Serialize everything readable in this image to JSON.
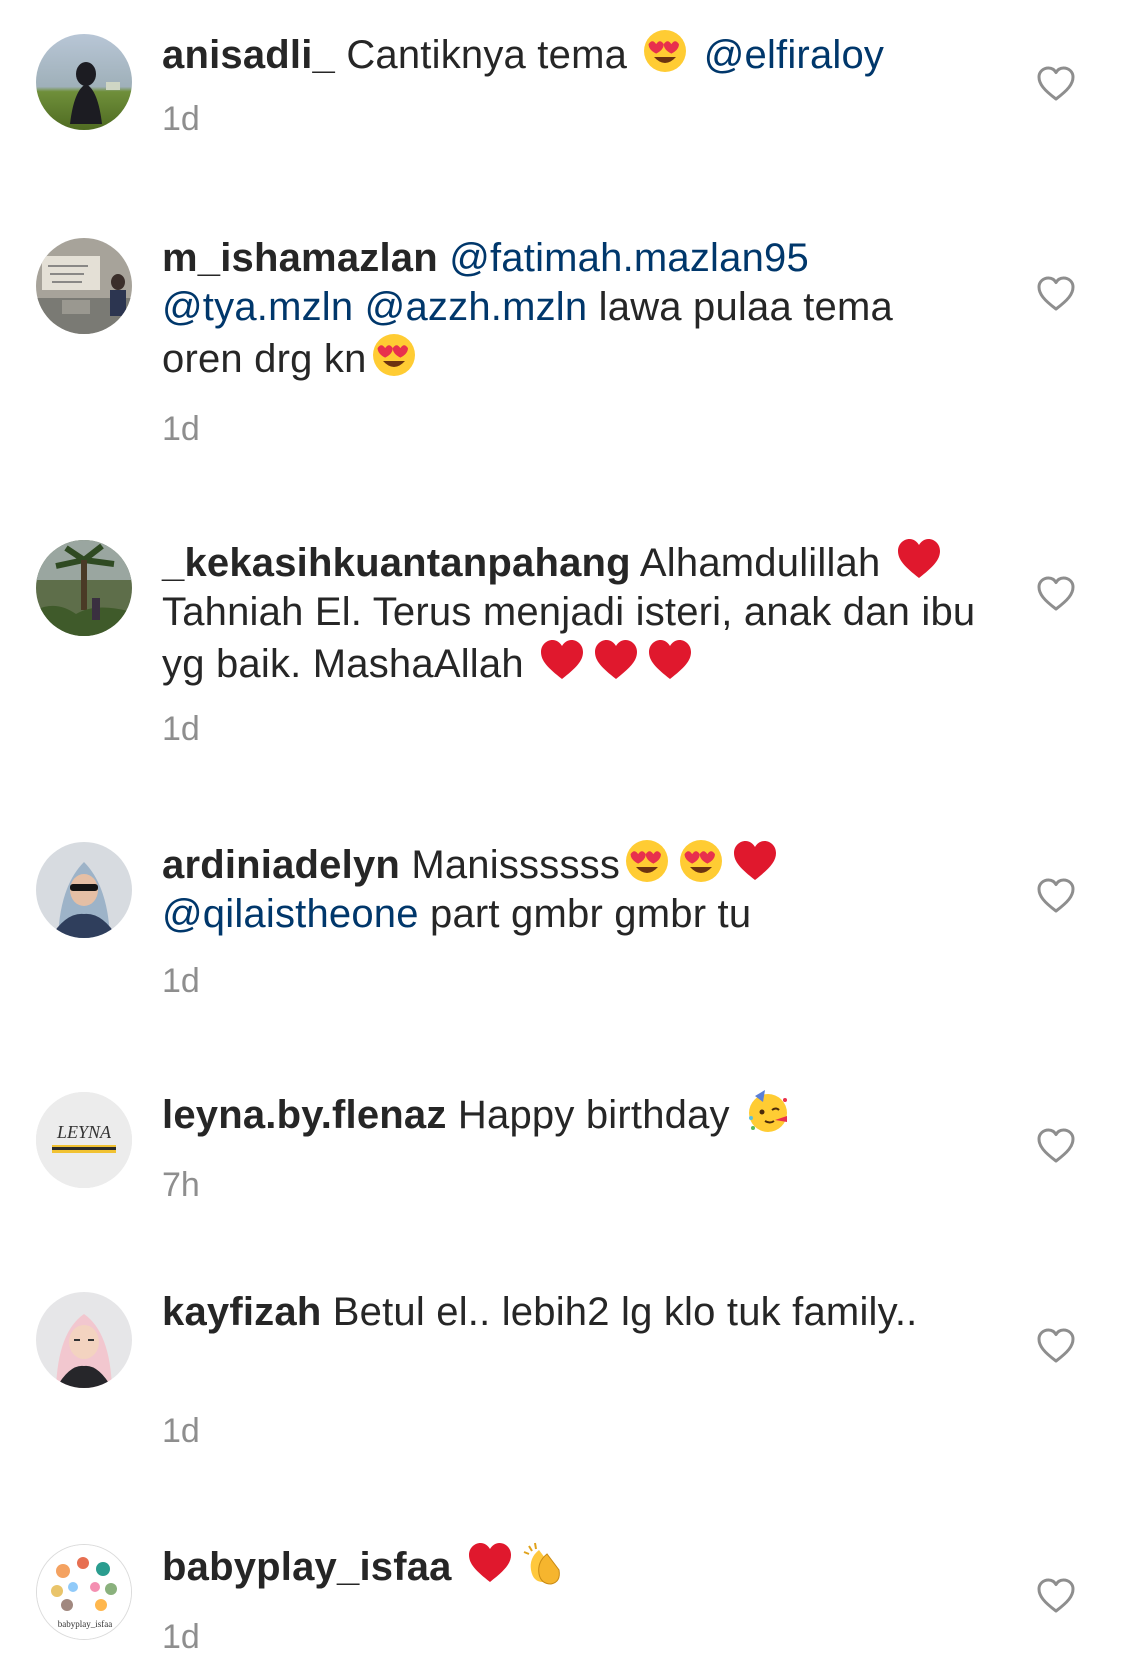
{
  "comments": [
    {
      "avatar_icon": "avatar-photo-person-hijab-outdoors",
      "username": "anisadli_",
      "parts": [
        {
          "t": "text",
          "v": "Cantiknya tema "
        },
        {
          "t": "emoji",
          "v": "heart-eyes"
        },
        {
          "t": "text",
          "v": " "
        },
        {
          "t": "mention",
          "v": "@elfiraloy"
        }
      ],
      "time": "1d"
    },
    {
      "avatar_icon": "avatar-photo-street-mural",
      "username": "m_ishamazlan",
      "parts": [
        {
          "t": "text",
          "v": " "
        },
        {
          "t": "mention",
          "v": "@fatimah.mazlan95"
        },
        {
          "t": "text",
          "v": " "
        },
        {
          "t": "mention",
          "v": "@tya.mzln"
        },
        {
          "t": "text",
          "v": " "
        },
        {
          "t": "mention",
          "v": "@azzh.mzln"
        },
        {
          "t": "text",
          "v": "  lawa pulaa tema oren drg kn"
        },
        {
          "t": "emoji",
          "v": "heart-eyes"
        }
      ],
      "time": "1d"
    },
    {
      "avatar_icon": "avatar-photo-palm-trees",
      "username": "_kekasihkuantanpahang",
      "parts": [
        {
          "t": "text",
          "v": " Alhamdulillah "
        },
        {
          "t": "emoji",
          "v": "red-heart"
        },
        {
          "t": "text",
          "v": " Tahniah El. Terus menjadi isteri, anak dan ibu yg baik. MashaAllah "
        },
        {
          "t": "emoji",
          "v": "red-heart"
        },
        {
          "t": "emoji",
          "v": "red-heart"
        },
        {
          "t": "emoji",
          "v": "red-heart"
        }
      ],
      "time": "1d"
    },
    {
      "avatar_icon": "avatar-photo-woman-hijab-sunglasses",
      "username": "ardiniadelyn",
      "parts": [
        {
          "t": "text",
          "v": " Manissssss"
        },
        {
          "t": "emoji",
          "v": "heart-eyes"
        },
        {
          "t": "emoji",
          "v": "heart-eyes"
        },
        {
          "t": "emoji",
          "v": "red-heart"
        },
        {
          "t": "text",
          "v": " "
        },
        {
          "t": "mention",
          "v": "@qilaistheone"
        },
        {
          "t": "text",
          "v": " part gmbr gmbr tu"
        }
      ],
      "time": "1d"
    },
    {
      "avatar_icon": "avatar-logo-leyna",
      "avatar_logo_text": "LEYNA",
      "username": "leyna.by.flenaz",
      "parts": [
        {
          "t": "text",
          "v": " Happy birthday "
        },
        {
          "t": "emoji",
          "v": "partying-face"
        }
      ],
      "time": "7h"
    },
    {
      "avatar_icon": "avatar-photo-woman-pink-hijab",
      "username": "kayfizah",
      "parts": [
        {
          "t": "text",
          "v": " Betul el.. lebih2 lg klo tuk family.."
        }
      ],
      "time": "1d"
    },
    {
      "avatar_icon": "avatar-logo-babyplay",
      "avatar_logo_text": "babyplay_isfaa",
      "username": "babyplay_isfaa",
      "parts": [
        {
          "t": "text",
          "v": " "
        },
        {
          "t": "emoji",
          "v": "red-heart"
        },
        {
          "t": "emoji",
          "v": "clapping-hands"
        }
      ],
      "time": "1d"
    }
  ],
  "like_icon": "heart-outline-icon",
  "colors": {
    "username": "#262626",
    "text": "#262626",
    "mention": "#00376b",
    "timestamp": "#8e8e8e",
    "like_icon": "#8e8e8e"
  }
}
